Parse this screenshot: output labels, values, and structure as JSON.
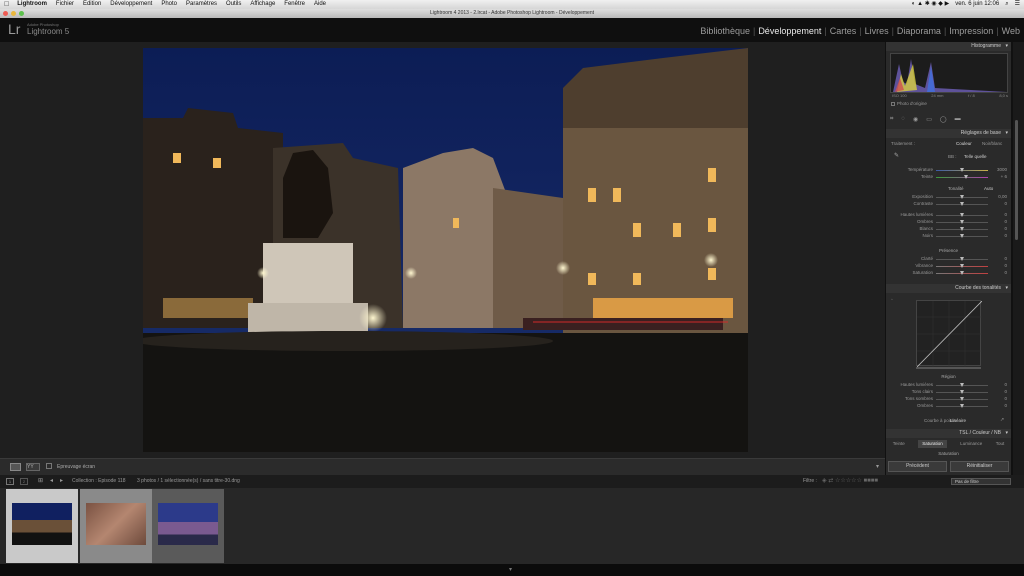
{
  "menubar": {
    "apple": "",
    "items": [
      "Lightroom",
      "Fichier",
      "Edition",
      "Développement",
      "Photo",
      "Paramètres",
      "Outils",
      "Affichage",
      "Fenêtre",
      "Aide"
    ],
    "clock": "ven. 6 juin  12:06"
  },
  "window": {
    "title": "Lightroom 4 2013 - 2.lrcat - Adobe Photoshop Lightroom - Développement"
  },
  "identity": {
    "lr": "Lr",
    "sub": "Adobe Photoshop",
    "name": "Lightroom 5"
  },
  "modules": [
    "Bibliothèque",
    "Développement",
    "Cartes",
    "Livres",
    "Diaporama",
    "Impression",
    "Web"
  ],
  "active_module": "Développement",
  "toolbar": {
    "soft_proof_label": "Epreuvage écran"
  },
  "panel": {
    "histogram_title": "Histogramme",
    "histogram_info": [
      "ISO 100",
      "24 mm",
      "f / 8",
      "8,0 s"
    ],
    "original_photo_label": "Photo d'origine",
    "basic_title": "Réglages de base",
    "treatment_label": "Traitement :",
    "treatment_color": "Couleur",
    "treatment_bw": "Noir/blanc",
    "wb_label": "BB :",
    "wb_value": "Telle quelle",
    "temp_label": "Température",
    "temp_value": "3000",
    "tint_label": "Teinte",
    "tint_value": "+ 6",
    "tone_label": "Tonalité",
    "tone_auto": "Auto",
    "tone_sliders": [
      {
        "label": "Exposition",
        "value": "0,00"
      },
      {
        "label": "Contraste",
        "value": "0"
      },
      {
        "label": "Hautes lumières",
        "value": "0"
      },
      {
        "label": "Ombres",
        "value": "0"
      },
      {
        "label": "Blancs",
        "value": "0"
      },
      {
        "label": "Noirs",
        "value": "0"
      }
    ],
    "presence_label": "Présence",
    "presence_sliders": [
      {
        "label": "Clarté",
        "value": "0"
      },
      {
        "label": "Vibrance",
        "value": "0"
      },
      {
        "label": "Saturation",
        "value": "0"
      }
    ],
    "curve_title": "Courbe des tonalités",
    "region_label": "Région",
    "region_sliders": [
      {
        "label": "Hautes lumières",
        "value": "0"
      },
      {
        "label": "Tons clairs",
        "value": "0"
      },
      {
        "label": "Tons sombres",
        "value": "0"
      },
      {
        "label": "Ombres",
        "value": "0"
      }
    ],
    "point_curve_label": "Courbe à points :",
    "point_curve_value": "Linéaire",
    "hsl_title": "TSL / Couleur / NB",
    "hsl_tabs": [
      "Teinte",
      "Saturation",
      "Luminance",
      "Tout"
    ],
    "hsl_sub": "Saturation",
    "previous_button": "Précédent",
    "reset_button": "Réinitialiser"
  },
  "filmbar": {
    "collection": "Collection : Episode 118",
    "count": "3 photos / 1 sélectionnée(s) / sans titre-30.dng",
    "filter_label": "Filtre :",
    "filter_value": "Pas de filtre"
  },
  "colors": {
    "accent": "#e8e8e8",
    "panel": "#2a2a2a",
    "background": "#1f1f1f"
  }
}
